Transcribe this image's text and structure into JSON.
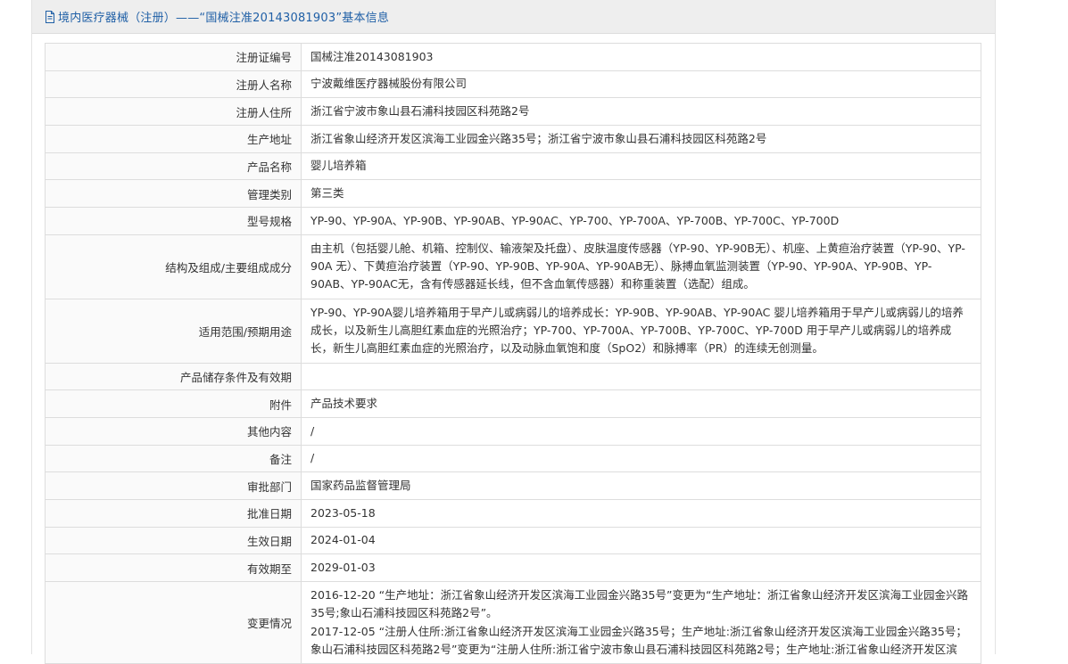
{
  "header": {
    "title": "境内医疗器械（注册）——“国械注准20143081903”基本信息",
    "icon": "document-icon"
  },
  "rows": [
    {
      "label": "注册证编号",
      "value": "国械注准20143081903"
    },
    {
      "label": "注册人名称",
      "value": "宁波戴维医疗器械股份有限公司"
    },
    {
      "label": "注册人住所",
      "value": "浙江省宁波市象山县石浦科技园区科苑路2号"
    },
    {
      "label": "生产地址",
      "value": "浙江省象山经济开发区滨海工业园金兴路35号；浙江省宁波市象山县石浦科技园区科苑路2号"
    },
    {
      "label": "产品名称",
      "value": "婴儿培养箱"
    },
    {
      "label": "管理类别",
      "value": "第三类"
    },
    {
      "label": "型号规格",
      "value": "YP-90、YP-90A、YP-90B、YP-90AB、YP-90AC、YP-700、YP-700A、YP-700B、YP-700C、YP-700D"
    },
    {
      "label": "结构及组成/主要组成成分",
      "value": "由主机（包括婴儿舱、机箱、控制仪、输液架及托盘）、皮肤温度传感器（YP-90、YP-90B无）、机座、上黄疸治疗装置（YP-90、YP-90A 无）、下黄疸治疗装置（YP-90、YP-90B、YP-90A、YP-90AB无）、脉搏血氧监测装置（YP-90、YP-90A、YP-90B、YP-90AB、YP-90AC无，含有传感器延长线，但不含血氧传感器）和称重装置（选配）组成。"
    },
    {
      "label": "适用范围/预期用途",
      "value": "YP-90、YP-90A婴儿培养箱用于早产儿或病弱儿的培养成长：YP-90B、YP-90AB、YP-90AC 婴儿培养箱用于早产儿或病弱儿的培养成长，以及新生儿高胆红素血症的光照治疗；YP-700、YP-700A、YP-700B、YP-700C、YP-700D 用于早产儿或病弱儿的培养成长，新生儿高胆红素血症的光照治疗，以及动脉血氧饱和度（SpO2）和脉搏率（PR）的连续无创测量。"
    },
    {
      "label": "产品储存条件及有效期",
      "value": ""
    },
    {
      "label": "附件",
      "value": "产品技术要求"
    },
    {
      "label": "其他内容",
      "value": "/"
    },
    {
      "label": "备注",
      "value": "/"
    },
    {
      "label": "审批部门",
      "value": "国家药品监督管理局"
    },
    {
      "label": "批准日期",
      "value": "2023-05-18"
    },
    {
      "label": "生效日期",
      "value": "2024-01-04"
    },
    {
      "label": "有效期至",
      "value": "2029-01-03"
    }
  ],
  "history": {
    "label": "变更情况",
    "entries": [
      "2016-12-20 “生产地址：浙江省象山经济开发区滨海工业园金兴路35号”变更为“生产地址：浙江省象山经济开发区滨海工业园金兴路35号;象山石浦科技园区科苑路2号”。",
      "2017-12-05 “注册人住所:浙江省象山经济开发区滨海工业园金兴路35号；生产地址:浙江省象山经济开发区滨海工业园金兴路35号；象山石浦科技园区科苑路2号”变更为“注册人住所:浙江省宁波市象山县石浦科技园区科苑路2号；生产地址:浙江省象山经济开发区滨"
    ]
  }
}
